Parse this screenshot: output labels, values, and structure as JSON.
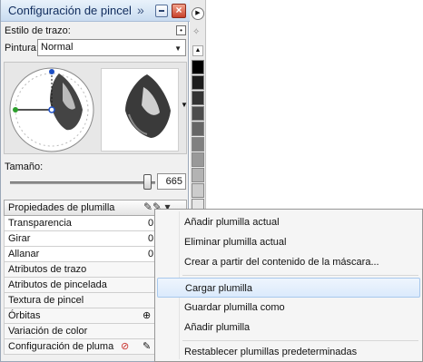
{
  "panel": {
    "title": "Configuración de pincel",
    "more_glyph": "»",
    "stroke_style_label": "Estilo de trazo:",
    "paint_label": "Pintura:",
    "paint_value": "Normal",
    "size_label": "Tamaño:",
    "size_value": "665",
    "nib_properties_label": "Propiedades de plumilla"
  },
  "properties": [
    {
      "label": "Transparencia",
      "value": "0"
    },
    {
      "label": "Girar",
      "value": "0"
    },
    {
      "label": "Allanar",
      "value": "0"
    },
    {
      "label": "Atributos de trazo",
      "value": ""
    },
    {
      "label": "Atributos de pincelada",
      "value": ""
    },
    {
      "label": "Textura de pincel",
      "value": ""
    },
    {
      "label": "Órbitas",
      "value": ""
    },
    {
      "label": "Variación de color",
      "value": ""
    },
    {
      "label": "Configuración de pluma",
      "value": ""
    }
  ],
  "context_menu": {
    "items": [
      "Añadir plumilla actual",
      "Eliminar plumilla actual",
      "Crear a partir del contenido de la máscara...",
      "Cargar plumilla",
      "Guardar plumilla como",
      "Añadir plumilla",
      "Restablecer plumillas predeterminadas"
    ],
    "highlighted_index": 3
  },
  "swatches": [
    "#000000",
    "#1c1c1c",
    "#333333",
    "#4d4d4d",
    "#666666",
    "#808080",
    "#999999",
    "#b3b3b3",
    "#cccccc",
    "#e6e6e6"
  ],
  "colors": {
    "accent": "#c9dcf0",
    "close": "#c7402a",
    "menu_highlight": "#dbeafc"
  }
}
